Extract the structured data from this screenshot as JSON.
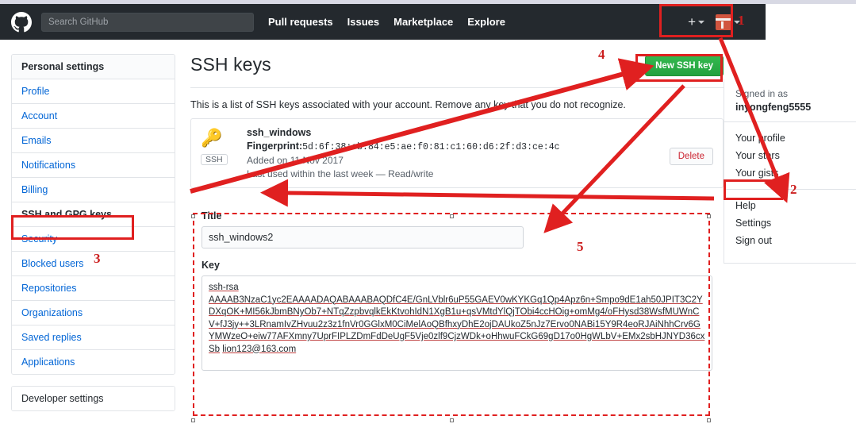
{
  "header": {
    "logo_icon": "github-mark-icon",
    "search_placeholder": "Search GitHub",
    "search_value": "",
    "nav": [
      {
        "label": "Pull requests"
      },
      {
        "label": "Issues"
      },
      {
        "label": "Marketplace"
      },
      {
        "label": "Explore"
      }
    ],
    "create_new_icon": "plus-icon",
    "create_new_caret_icon": "chevron-down-icon",
    "avatar_icon": "user-avatar-icon",
    "avatar_caret_icon": "chevron-down-icon"
  },
  "sidebar": {
    "heading": "Personal settings",
    "items": [
      {
        "label": "Profile"
      },
      {
        "label": "Account"
      },
      {
        "label": "Emails"
      },
      {
        "label": "Notifications"
      },
      {
        "label": "Billing"
      },
      {
        "label": "SSH and GPG keys"
      },
      {
        "label": "Security"
      },
      {
        "label": "Blocked users"
      },
      {
        "label": "Repositories"
      },
      {
        "label": "Organizations"
      },
      {
        "label": "Saved replies"
      },
      {
        "label": "Applications"
      }
    ],
    "developer": {
      "label": "Developer settings"
    }
  },
  "main": {
    "title": "SSH keys",
    "new_key_button": "New SSH key",
    "intro": "This is a list of SSH keys associated with your account. Remove any key that you do not recognize.",
    "key_card": {
      "key_icon": "key-icon",
      "badge": "SSH",
      "name": "ssh_windows",
      "fingerprint_label": "Fingerprint:",
      "fingerprint": "5d:6f:38:cb:84:e5:ae:f0:81:c1:60:d6:2f:d3:ce:4c",
      "added": "Added on 11 Nov 2017",
      "last_used": "Last used within the last week — Read/write",
      "delete_button": "Delete"
    },
    "form": {
      "title_label": "Title",
      "title_value": "ssh_windows2",
      "title_placeholder": "",
      "key_label": "Key",
      "key_placeholder": "",
      "key_value": "ssh-rsa AAAAB3NzaC1yc2EAAAADAQABAAABAQDfC4E/GnLVblr6uP55GAEV0wKYKGq1Qp4Apz6n+Smpo9dE1ah50JPIT3C2YDXqOK+MI56kJbmBNyOb7+NTqZzpbvqlkEkKtvohIdN1XgB1u+qsVMtdYlQjTObi4ccHOig+omMg4/oFHysd38WsfMUWnCV+fJ3jy++3LRnamIvZHvuu2z3z1fnVr0GGlxM0CiMelAoQBfhxyDhE2ojDAUkoZ5nJz7Ervo0NABi15Y9R4eoRJAiNhhCrv6GYMWzeO+eiw77AFXmny7UprFIPLZDmFdDeUgF5Vje0zlf9CjzWDk+oHhwuFCkG69gD17o0HgWLbV+EMx2sbHJNYD36cxSb lion123@163.com"
    }
  },
  "user_dropdown": {
    "signed_in_as": "Signed in as",
    "username": "inyongfeng5555",
    "items": [
      {
        "label": "Your profile"
      },
      {
        "label": "Your stars"
      },
      {
        "label": "Your gists"
      }
    ],
    "items2": [
      {
        "label": "Help"
      },
      {
        "label": "Settings"
      },
      {
        "label": "Sign out"
      }
    ]
  },
  "annotations": {
    "color": "#e02020",
    "numbers": [
      {
        "id": "1",
        "text": "1"
      },
      {
        "id": "2",
        "text": "2"
      },
      {
        "id": "3",
        "text": "3"
      },
      {
        "id": "4",
        "text": "4"
      },
      {
        "id": "5",
        "text": "5"
      }
    ]
  }
}
